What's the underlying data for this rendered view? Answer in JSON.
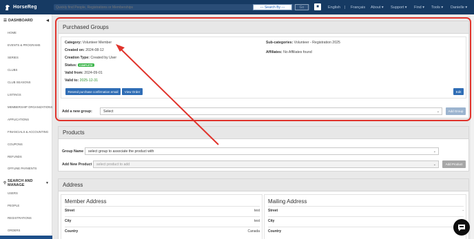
{
  "app": {
    "logo_text": "HorseReg"
  },
  "header": {
    "search_placeholder": "Quickly find People, Registrations or Memberships",
    "search_by": "--- Search By ---",
    "go_label": "Go",
    "nav": [
      "English",
      "|",
      "Français",
      "About ▾",
      "Support ▾",
      "Find ▾",
      "Tools ▾",
      "Danielle ▾"
    ]
  },
  "sidebar": {
    "dashboard_label": "DASHBOARD",
    "dashboard_items": [
      "HOME",
      "EVENTS & PROGRAMS",
      "SERIES",
      "CLUBS",
      "CLUB SEASONS",
      "LISTINGS",
      "MEMBERSHIP ORGANIZATIONS",
      "APPLICATIONS",
      "FINANCIALS & ACCOUNTING",
      "COUPONS",
      "REFUNDS",
      "OFFLINE PAYMENTS"
    ],
    "search_label": "SEARCH AND MANAGE",
    "search_items": [
      "USERS",
      "PEOPLE",
      "REGISTRATIONS",
      "ORDERS"
    ]
  },
  "purchased_groups": {
    "title": "Purchased Groups",
    "category_label": "Category:",
    "category_value": "Volunteer Member",
    "created_label": "Created on:",
    "created_value": "2024-08-12",
    "creation_type_label": "Creation Type:",
    "creation_type_value": "Created by User",
    "status_label": "Status:",
    "status_value": "COMPLETE",
    "valid_from_label": "Valid from:",
    "valid_from_value": "2024-09-01",
    "valid_to_label": "Valid to:",
    "valid_to_value": "2025-12-31",
    "subcategories_label": "Sub-categories:",
    "subcategories_value": "Volunteer - Registration 2025",
    "affiliates_label": "Affiliates:",
    "affiliates_value": "No Affiliates found",
    "resend_label": "Resend purchase confirmation email",
    "view_order_label": "View Order",
    "edit_label": "Edit",
    "add_group_label": "Add a new group:",
    "add_group_select": "Select",
    "add_group_button": "Add Group"
  },
  "products": {
    "title": "Products",
    "group_name_label": "Group Name",
    "group_name_select": "select group to associate the product with",
    "add_product_label": "Add New Product",
    "add_product_select": "select product to add",
    "add_product_button": "Add Product"
  },
  "address": {
    "title": "Address",
    "member_title": "Member Address",
    "mailing_title": "Mailing Address",
    "member_rows": [
      {
        "key": "Street",
        "value": "test"
      },
      {
        "key": "City",
        "value": "test"
      },
      {
        "key": "Country",
        "value": "Canada"
      }
    ],
    "mailing_rows": [
      {
        "key": "Street",
        "value": "-"
      },
      {
        "key": "City",
        "value": ""
      },
      {
        "key": "Country",
        "value": ""
      }
    ]
  },
  "colors": {
    "brand": "#163a63",
    "button_blue": "#2f6db5",
    "highlight_red": "#e0332b",
    "status_green": "#3bb54a"
  }
}
